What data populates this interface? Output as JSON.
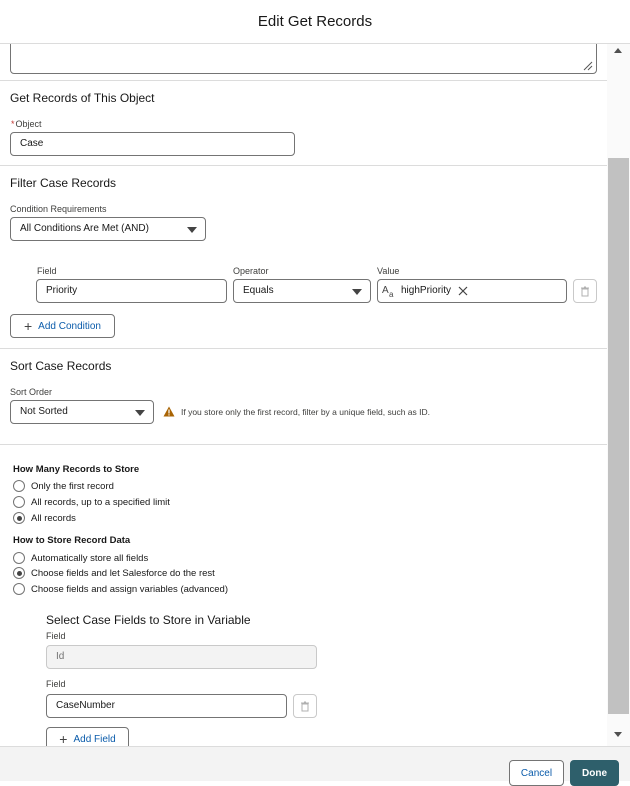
{
  "header": {
    "title": "Edit Get Records"
  },
  "object_section": {
    "title": "Get Records of This Object",
    "object_label": "Object",
    "required_mark": "*",
    "object_value": "Case"
  },
  "filter_section": {
    "title": "Filter Case Records",
    "condition_label": "Condition Requirements",
    "condition_value": "All Conditions Are Met (AND)",
    "field_header": "Field",
    "operator_header": "Operator",
    "value_header": "Value",
    "row": {
      "field": "Priority",
      "operator": "Equals",
      "value": "highPriority"
    },
    "add_condition_label": "Add Condition"
  },
  "sort_section": {
    "title": "Sort Case Records",
    "sort_label": "Sort Order",
    "sort_value": "Not Sorted",
    "warning": "If you store only the first record, filter by a unique field, such as ID."
  },
  "store_section": {
    "how_many_label": "How Many Records to Store",
    "how_many_options": [
      "Only the first record",
      "All records, up to a specified limit",
      "All records"
    ],
    "how_many_selected": 2,
    "how_store_label": "How to Store Record Data",
    "how_store_options": [
      "Automatically store all fields",
      "Choose fields and let Salesforce do the rest",
      "Choose fields and assign variables (advanced)"
    ],
    "how_store_selected": 1,
    "fields_title": "Select Case Fields to Store in Variable",
    "field_label": "Field",
    "fields": [
      "Id",
      "CaseNumber"
    ],
    "add_field_label": "Add Field"
  },
  "footer": {
    "cancel_label": "Cancel",
    "done_label": "Done"
  },
  "colors": {
    "brand": "#2e5f6b",
    "link": "#0b5cab",
    "warning": "#a96404"
  }
}
